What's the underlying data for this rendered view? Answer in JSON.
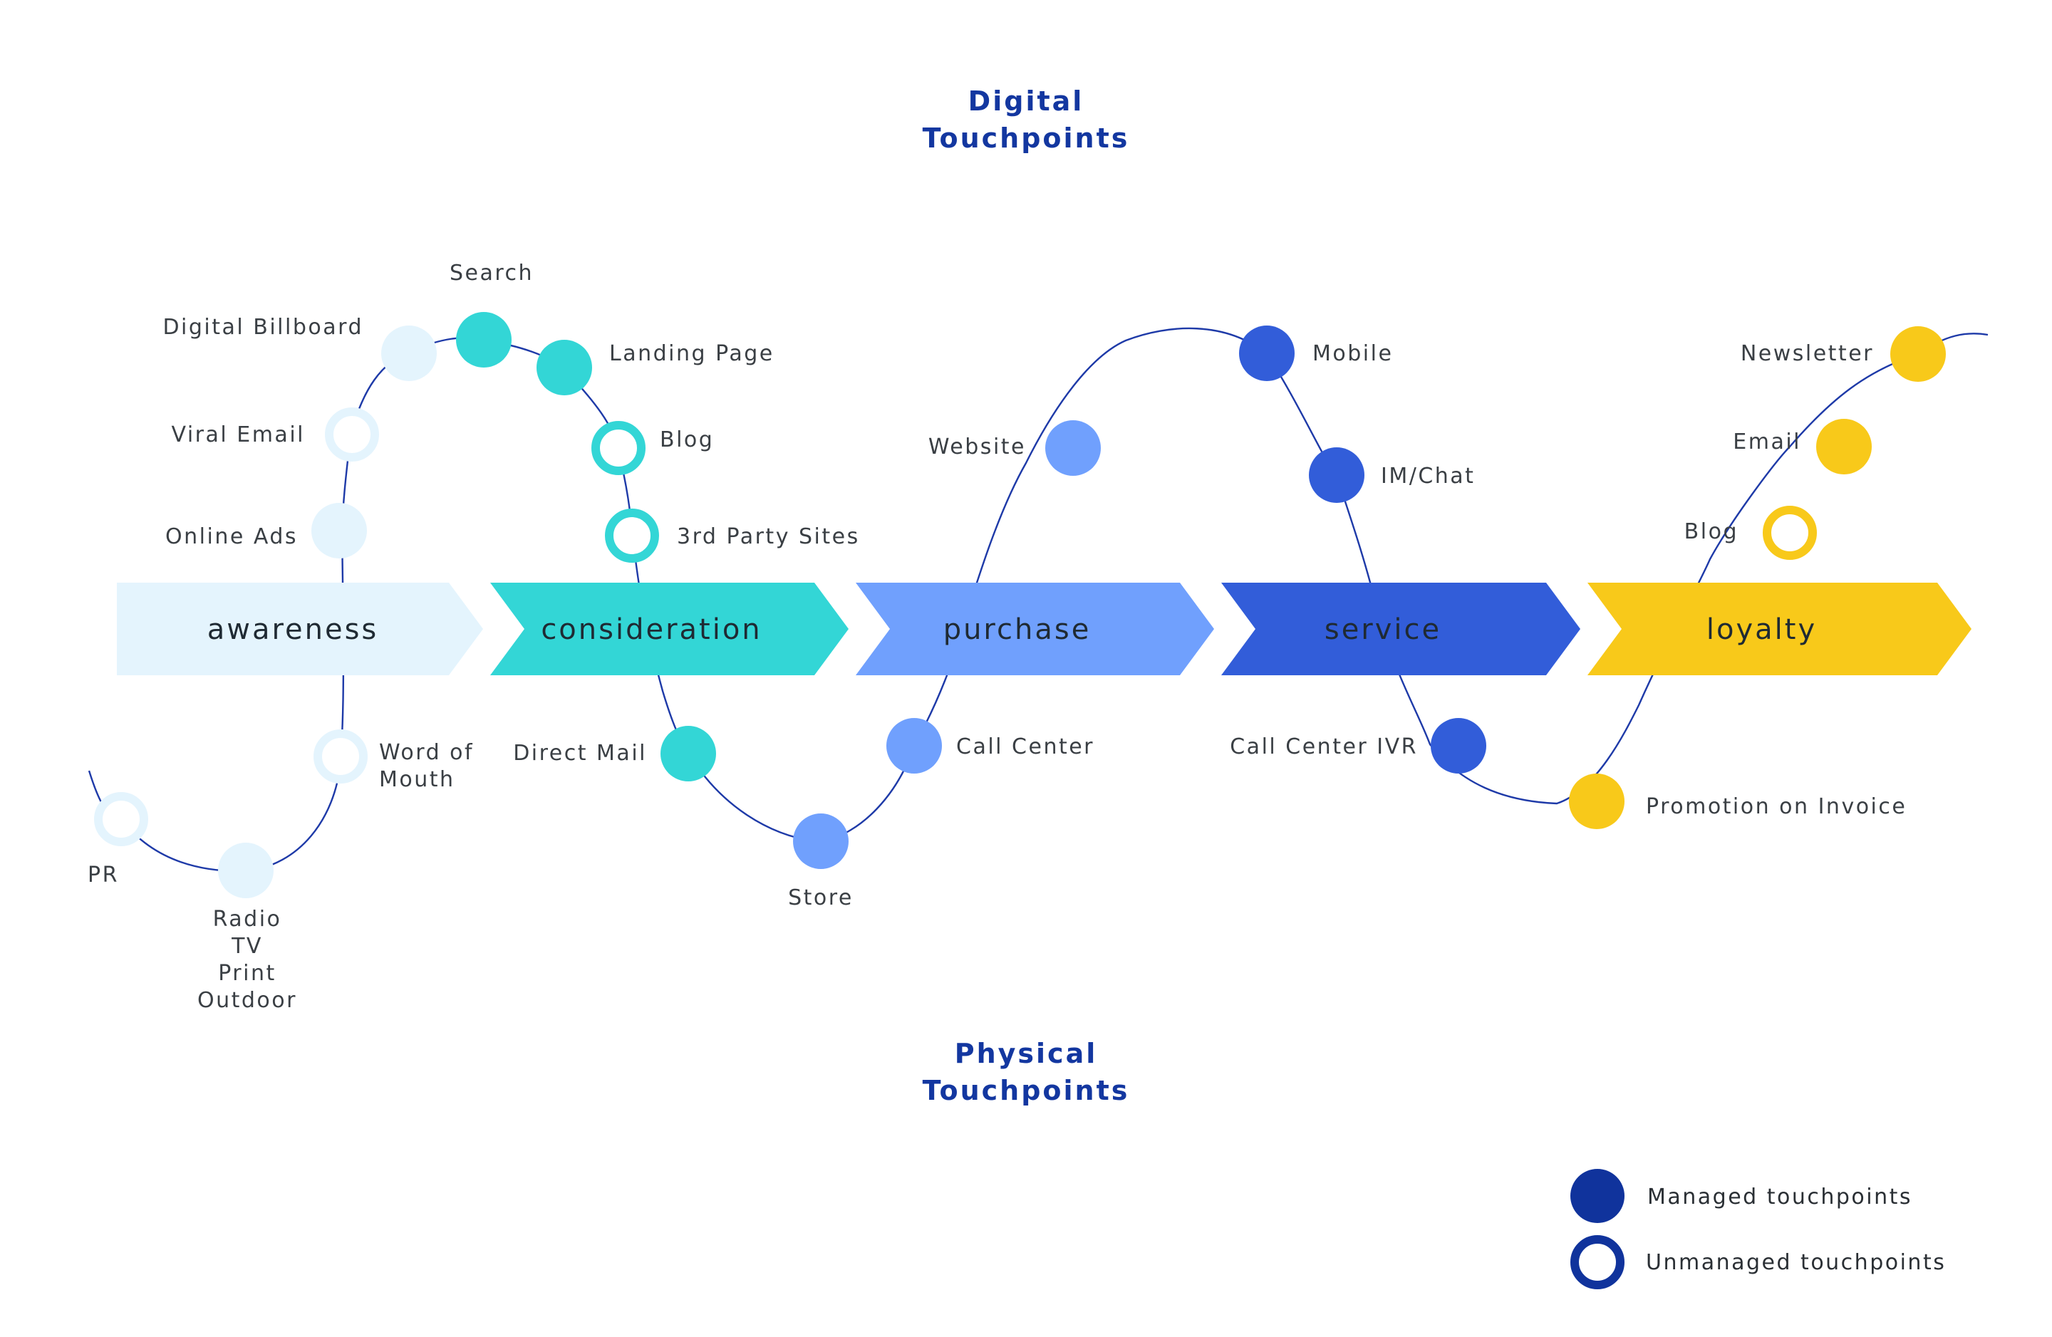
{
  "titles": {
    "digital": [
      "Digital",
      "Touchpoints"
    ],
    "physical": [
      "Physical",
      "Touchpoints"
    ]
  },
  "colors": {
    "path": "#1e3aa8",
    "title": "#1337a0",
    "awareness": "#e4f4fd",
    "consideration": "#33d6d6",
    "purchase": "#70a0fd",
    "service": "#325dd9",
    "loyalty": "#f8c91a",
    "legend": "#10339c"
  },
  "stages": [
    {
      "id": "awareness",
      "label": "awareness"
    },
    {
      "id": "consideration",
      "label": "consideration"
    },
    {
      "id": "purchase",
      "label": "purchase"
    },
    {
      "id": "service",
      "label": "service"
    },
    {
      "id": "loyalty",
      "label": "loyalty"
    }
  ],
  "touchpoints": [
    {
      "label": "PR",
      "stage": "awareness",
      "managed": false,
      "channel": "physical"
    },
    {
      "label": "Radio\nTV\nPrint\nOutdoor",
      "stage": "awareness",
      "managed": true,
      "channel": "physical"
    },
    {
      "label": "Word of\nMouth",
      "stage": "awareness",
      "managed": false,
      "channel": "physical"
    },
    {
      "label": "Online Ads",
      "stage": "awareness",
      "managed": true,
      "channel": "digital"
    },
    {
      "label": "Viral Email",
      "stage": "awareness",
      "managed": false,
      "channel": "digital"
    },
    {
      "label": "Digital Billboard",
      "stage": "awareness",
      "managed": true,
      "channel": "digital"
    },
    {
      "label": "Search",
      "stage": "consideration",
      "managed": true,
      "channel": "digital"
    },
    {
      "label": "Landing Page",
      "stage": "consideration",
      "managed": true,
      "channel": "digital"
    },
    {
      "label": "Blog",
      "stage": "consideration",
      "managed": false,
      "channel": "digital"
    },
    {
      "label": "3rd Party Sites",
      "stage": "consideration",
      "managed": false,
      "channel": "digital"
    },
    {
      "label": "Direct Mail",
      "stage": "consideration",
      "managed": true,
      "channel": "physical"
    },
    {
      "label": "Store",
      "stage": "purchase",
      "managed": true,
      "channel": "physical"
    },
    {
      "label": "Call Center",
      "stage": "purchase",
      "managed": true,
      "channel": "physical"
    },
    {
      "label": "Website",
      "stage": "purchase",
      "managed": true,
      "channel": "digital"
    },
    {
      "label": "Mobile",
      "stage": "service",
      "managed": true,
      "channel": "digital"
    },
    {
      "label": "IM/Chat",
      "stage": "service",
      "managed": true,
      "channel": "digital"
    },
    {
      "label": "Call Center IVR",
      "stage": "service",
      "managed": true,
      "channel": "physical"
    },
    {
      "label": "Promotion on Invoice",
      "stage": "loyalty",
      "managed": true,
      "channel": "physical"
    },
    {
      "label": "Blog",
      "stage": "loyalty",
      "managed": false,
      "channel": "digital"
    },
    {
      "label": "Email",
      "stage": "loyalty",
      "managed": true,
      "channel": "digital"
    },
    {
      "label": "Newsletter",
      "stage": "loyalty",
      "managed": true,
      "channel": "digital"
    }
  ],
  "legend": {
    "managed": "Managed touchpoints",
    "unmanaged": "Unmanaged touchpoints"
  }
}
